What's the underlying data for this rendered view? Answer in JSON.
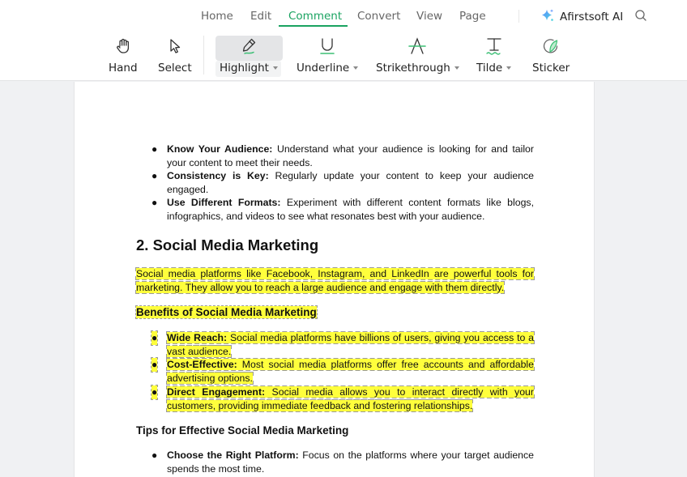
{
  "menu": {
    "tabs": [
      {
        "label": "Home"
      },
      {
        "label": "Edit"
      },
      {
        "label": "Comment",
        "active": true
      },
      {
        "label": "Convert"
      },
      {
        "label": "View"
      },
      {
        "label": "Page"
      }
    ],
    "ai_label": "Afirstsoft AI",
    "accent_color": "#1aa361"
  },
  "toolbar": {
    "tools": [
      {
        "label": "Hand",
        "icon": "hand-icon"
      },
      {
        "label": "Select",
        "icon": "cursor-icon"
      },
      {
        "label": "Highlight",
        "icon": "highlight-pen-icon",
        "dropdown": true,
        "selected": true
      },
      {
        "label": "Underline",
        "icon": "underline-icon",
        "dropdown": true
      },
      {
        "label": "Strikethrough",
        "icon": "strikethrough-icon",
        "dropdown": true
      },
      {
        "label": "Tilde",
        "icon": "tilde-icon",
        "dropdown": true
      },
      {
        "label": "Sticker",
        "icon": "sticker-icon"
      }
    ]
  },
  "document": {
    "intro_list": [
      {
        "bold": "Know Your Audience:",
        "text": " Understand what your audience is looking for and tailor your content to meet their needs."
      },
      {
        "bold": "Consistency is Key:",
        "text": " Regularly update your content to keep your audience engaged."
      },
      {
        "bold": "Use Different Formats:",
        "text": " Experiment with different content formats like blogs, infographics, and videos to see what resonates best with your audience."
      }
    ],
    "section_title": "2. Social Media Marketing",
    "section_para": "Social media platforms like Facebook, Instagram, and LinkedIn are powerful tools for marketing. They allow you to reach a large audience and engage with them directly.",
    "benefits_heading": "Benefits of Social Media Marketing",
    "benefits_list": [
      {
        "bold": "Wide Reach:",
        "text": " Social media platforms have billions of users, giving you access to a vast audience."
      },
      {
        "bold": "Cost-Effective:",
        "text": " Most social media platforms offer free accounts and affordable advertising options."
      },
      {
        "bold": "Direct Engagement:",
        "text": " Social media allows you to interact directly with your customers, providing immediate feedback and fostering relationships."
      }
    ],
    "tips_heading": "Tips for Effective Social Media Marketing",
    "tips_list": [
      {
        "bold": "Choose the Right Platform:",
        "text": " Focus on the platforms where your target audience spends the most time."
      }
    ],
    "highlight_color": "#ffff3c"
  }
}
